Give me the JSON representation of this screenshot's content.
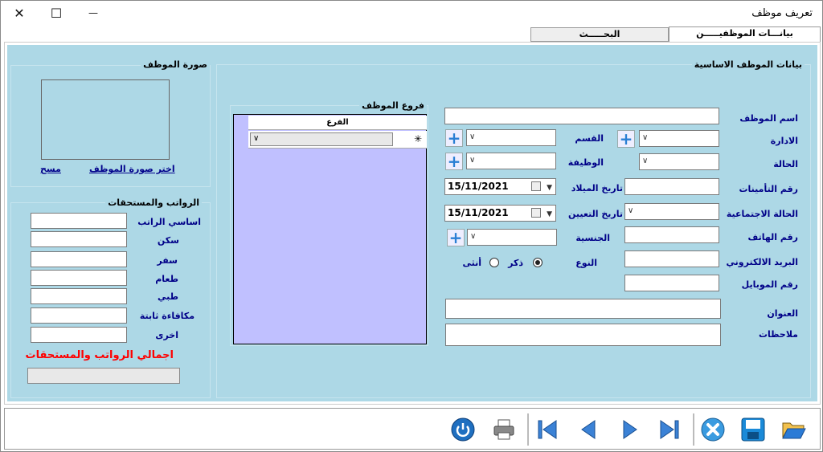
{
  "window": {
    "title": "تعريف موظف",
    "close_glyph": "✕",
    "maximize_glyph": "☐",
    "minimize_glyph": "—"
  },
  "tabs": [
    {
      "label": "بيانـــات الموظفيـــــن",
      "active": true
    },
    {
      "label": "البحـــــث",
      "active": false
    }
  ],
  "basic_info": {
    "title": "بيانات الموظف الاساسية",
    "name_label": "اسم الموظف",
    "admin_label": "الادارة",
    "dept_label": "القسم",
    "status_label": "الحالة",
    "job_label": "الوظيفة",
    "insurance_label": "رقم التأمينات",
    "birth_label": "تاريخ الميلاد",
    "birth_value": "15/11/2021",
    "social_label": "الحالة الاجتماعية",
    "hire_label": "تاريخ التعيين",
    "hire_value": "15/11/2021",
    "phone_label": "رقم الهاتف",
    "nationality_label": "الجنسية",
    "email_label": "البريد الالكتروني",
    "gender_label": "النوع",
    "male_label": "ذكر",
    "female_label": "أنثى",
    "mobile_label": "رقم الموبايل",
    "address_label": "العنوان",
    "notes_label": "ملاحظات"
  },
  "branches": {
    "title": "فروع الموظف",
    "column": "الفرع",
    "new_row_marker": "✳"
  },
  "photo": {
    "title": "صورة الموظف",
    "choose_link": "اختر صورة الموظف",
    "clear_link": "مسح"
  },
  "salaries": {
    "title": "الرواتب والمستحقات",
    "items": [
      "اساسي الراتب",
      "سكن",
      "سفر",
      "طعام",
      "طبي",
      "مكافاءة ثابتة",
      "اخرى"
    ],
    "total_label": "اجمالي الرواتب والمستحقات",
    "total_color": "#ff0000"
  },
  "colors": {
    "panel": "#add8e6",
    "grid": "#c0c0ff",
    "label": "#000088",
    "accent": "#2a7fd4"
  },
  "toolbar_icons": [
    "open-folder-icon",
    "save-icon",
    "cancel-icon",
    "last-record-icon",
    "next-record-icon",
    "previous-record-icon",
    "first-record-icon",
    "print-icon",
    "power-icon"
  ]
}
